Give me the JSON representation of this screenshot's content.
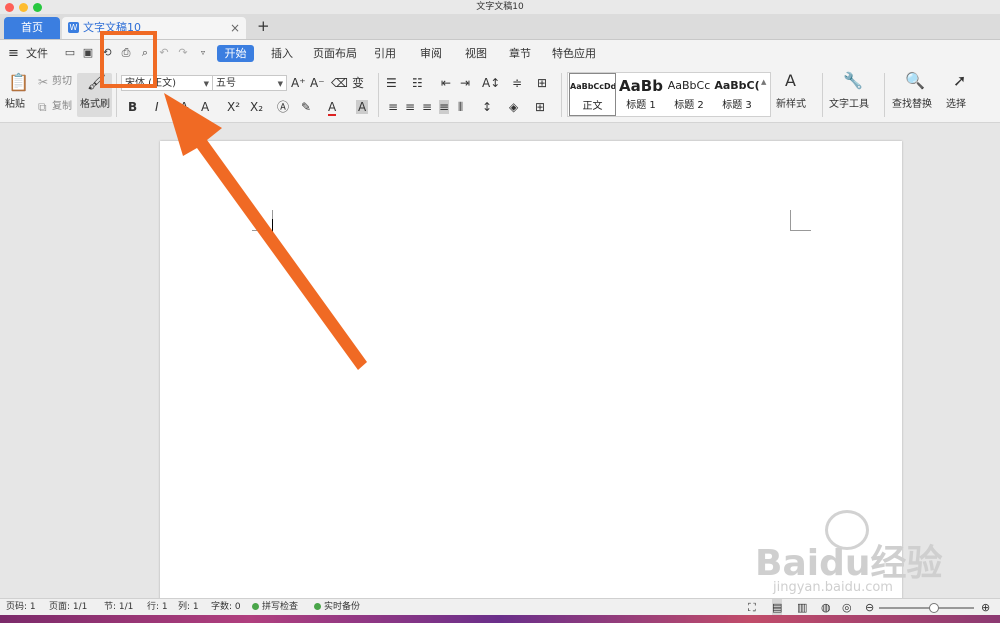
{
  "window": {
    "title": "文字文稿10"
  },
  "tabs": {
    "home": "首页",
    "doc": "文字文稿10",
    "add": "+",
    "doc_icon": "W",
    "close": "×"
  },
  "menu": {
    "file": "文件",
    "items": [
      "开始",
      "插入",
      "页面布局",
      "引用",
      "审阅",
      "视图",
      "章节",
      "特色应用"
    ]
  },
  "ribbon": {
    "paste": "粘贴",
    "cut": "剪切",
    "copy": "复制",
    "format_painter": "格式刷",
    "font_name": "宋体 (正文)",
    "font_size": "五号",
    "bold": "B",
    "italic": "I",
    "styles": [
      {
        "sample": "AaBbCcDd",
        "name": "正文"
      },
      {
        "sample": "AaBb",
        "name": "标题 1"
      },
      {
        "sample": "AaBbCc",
        "name": "标题 2"
      },
      {
        "sample": "AaBbC(",
        "name": "标题 3"
      }
    ],
    "new_style": "新样式",
    "text_tools": "文字工具",
    "find_replace": "查找替换",
    "select": "选择"
  },
  "status": {
    "page_num": "页码: 1",
    "pages": "页面: 1/1",
    "section": "节: 1/1",
    "row": "行: 1",
    "col": "列: 1",
    "words": "字数: 0",
    "spell": "拼写检查",
    "backup": "实时备份"
  },
  "watermark": {
    "brand": "Baidu经验",
    "url": "jingyan.baidu.com"
  },
  "colors": {
    "accent": "#3b7ee0",
    "annotation": "#f06a24"
  }
}
